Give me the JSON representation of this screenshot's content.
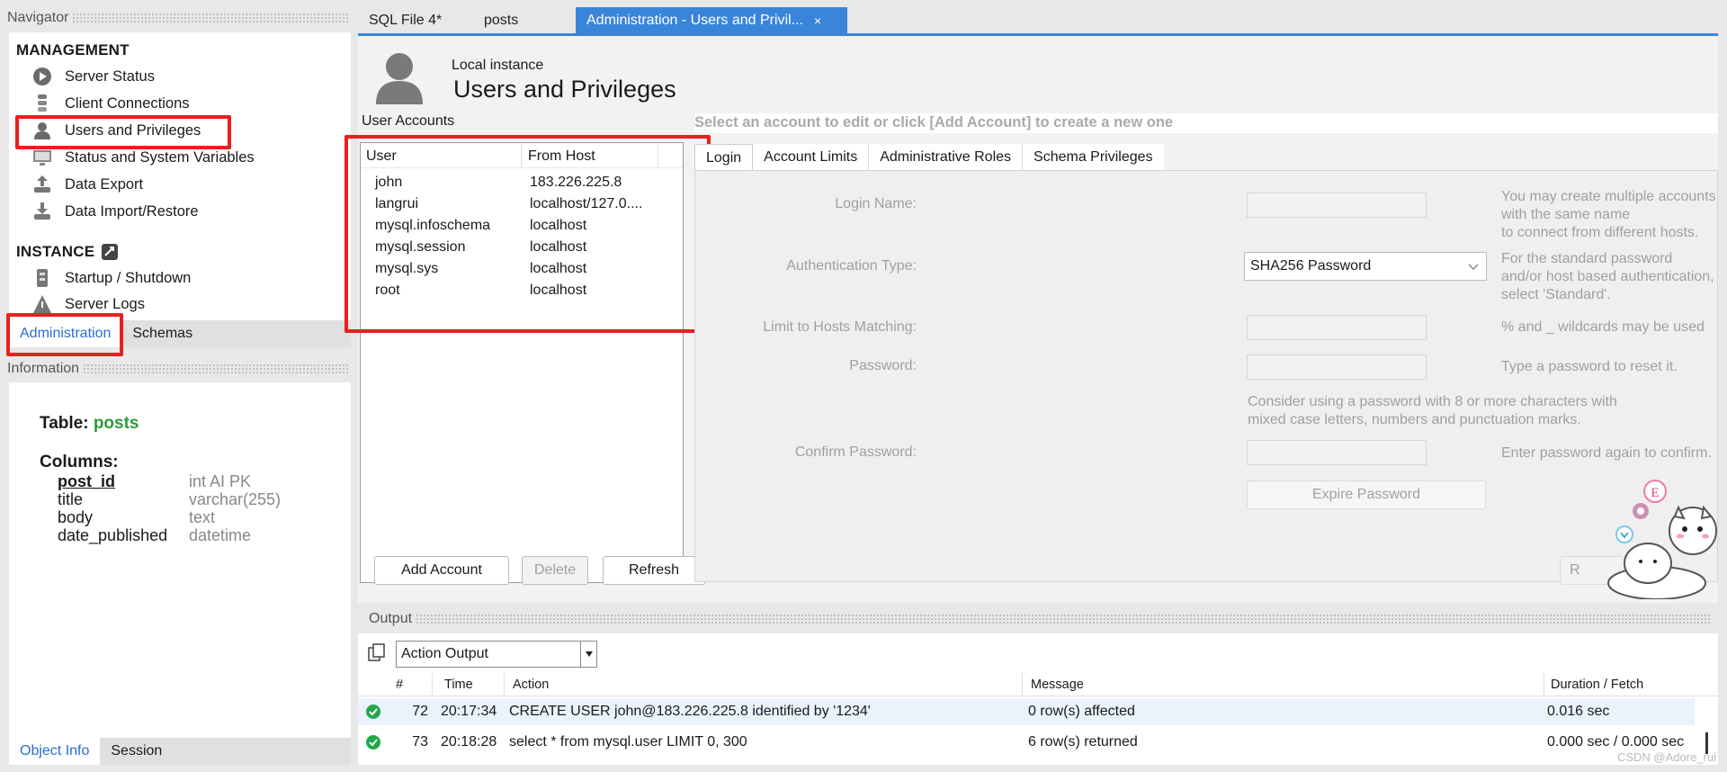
{
  "navigator": {
    "title": "Navigator",
    "management_title": "MANAGEMENT",
    "management_items": [
      {
        "label": "Server Status",
        "icon": "server-status-icon"
      },
      {
        "label": "Client Connections",
        "icon": "client-connections-icon"
      },
      {
        "label": "Users and Privileges",
        "icon": "user-icon"
      },
      {
        "label": "Status and System Variables",
        "icon": "monitor-icon"
      },
      {
        "label": "Data Export",
        "icon": "export-icon"
      },
      {
        "label": "Data Import/Restore",
        "icon": "import-icon"
      }
    ],
    "instance_title": "INSTANCE",
    "instance_items": [
      {
        "label": "Startup / Shutdown",
        "icon": "startup-icon"
      },
      {
        "label": "Server Logs",
        "icon": "warning-icon"
      }
    ],
    "tabs": [
      "Administration",
      "Schemas"
    ]
  },
  "information": {
    "title": "Information",
    "table_label": "Table:",
    "table_name": "posts",
    "columns_label": "Columns:",
    "columns": [
      {
        "name": "post_id",
        "type": "int AI PK"
      },
      {
        "name": "title",
        "type": "varchar(255)"
      },
      {
        "name": "body",
        "type": "text"
      },
      {
        "name": "date_published",
        "type": "datetime"
      }
    ],
    "bottom_tabs": [
      "Object Info",
      "Session"
    ]
  },
  "editor_tabs": [
    {
      "label": "SQL File 4*"
    },
    {
      "label": "posts"
    },
    {
      "label": "Administration - Users and Privil...",
      "close": "×"
    }
  ],
  "header": {
    "subtitle": "Local instance",
    "title": "Users and Privileges"
  },
  "accounts": {
    "title": "User Accounts",
    "columns": [
      "User",
      "From Host"
    ],
    "rows": [
      {
        "user": "john",
        "host": "183.226.225.8"
      },
      {
        "user": "langrui",
        "host": "localhost/127.0...."
      },
      {
        "user": "mysql.infoschema",
        "host": "localhost"
      },
      {
        "user": "mysql.session",
        "host": "localhost"
      },
      {
        "user": "mysql.sys",
        "host": "localhost"
      },
      {
        "user": "root",
        "host": "localhost"
      }
    ],
    "buttons": {
      "add": "Add Account",
      "delete": "Delete",
      "refresh": "Refresh"
    }
  },
  "details": {
    "prompt": "Select an account to edit or click [Add Account] to create a new one",
    "tabs": [
      "Login",
      "Account Limits",
      "Administrative Roles",
      "Schema Privileges"
    ],
    "login_name_label": "Login Name:",
    "login_name_hint_1": "You may create multiple accounts with the same name",
    "login_name_hint_2": "to connect from different hosts.",
    "auth_type_label": "Authentication Type:",
    "auth_type_value": "SHA256 Password",
    "auth_type_hint_1": "For the standard password and/or host based authentication,",
    "auth_type_hint_2": "select 'Standard'.",
    "hosts_label": "Limit to Hosts Matching:",
    "hosts_hint": "% and _ wildcards may be used",
    "password_label": "Password:",
    "password_hint": "Type a password to reset it.",
    "password_advice_1": "Consider using a password with 8 or more characters with",
    "password_advice_2": "mixed case letters, numbers and punctuation marks.",
    "confirm_label": "Confirm Password:",
    "confirm_hint": "Enter password again to confirm.",
    "expire_button": "Expire Password",
    "revert_partial": "R"
  },
  "output": {
    "title": "Output",
    "selector_value": "Action Output",
    "columns": [
      "#",
      "Time",
      "Action",
      "Message",
      "Duration / Fetch"
    ],
    "rows": [
      {
        "num": "72",
        "time": "20:17:34",
        "action": "CREATE USER john@183.226.225.8 identified by '1234'",
        "message": "0 row(s) affected",
        "duration": "0.016 sec"
      },
      {
        "num": "73",
        "time": "20:18:28",
        "action": "select * from mysql.user LIMIT 0, 300",
        "message": "6 row(s) returned",
        "duration": "0.000 sec / 0.000 sec"
      }
    ]
  },
  "watermark": "CSDN @Adore_rui",
  "sticker_letter": "E",
  "colors": {
    "accent": "#3a85d9",
    "highlight_box": "#e8201e",
    "link": "#2a6fc9",
    "table_name": "#2e9a3c",
    "success": "#22a84a"
  }
}
